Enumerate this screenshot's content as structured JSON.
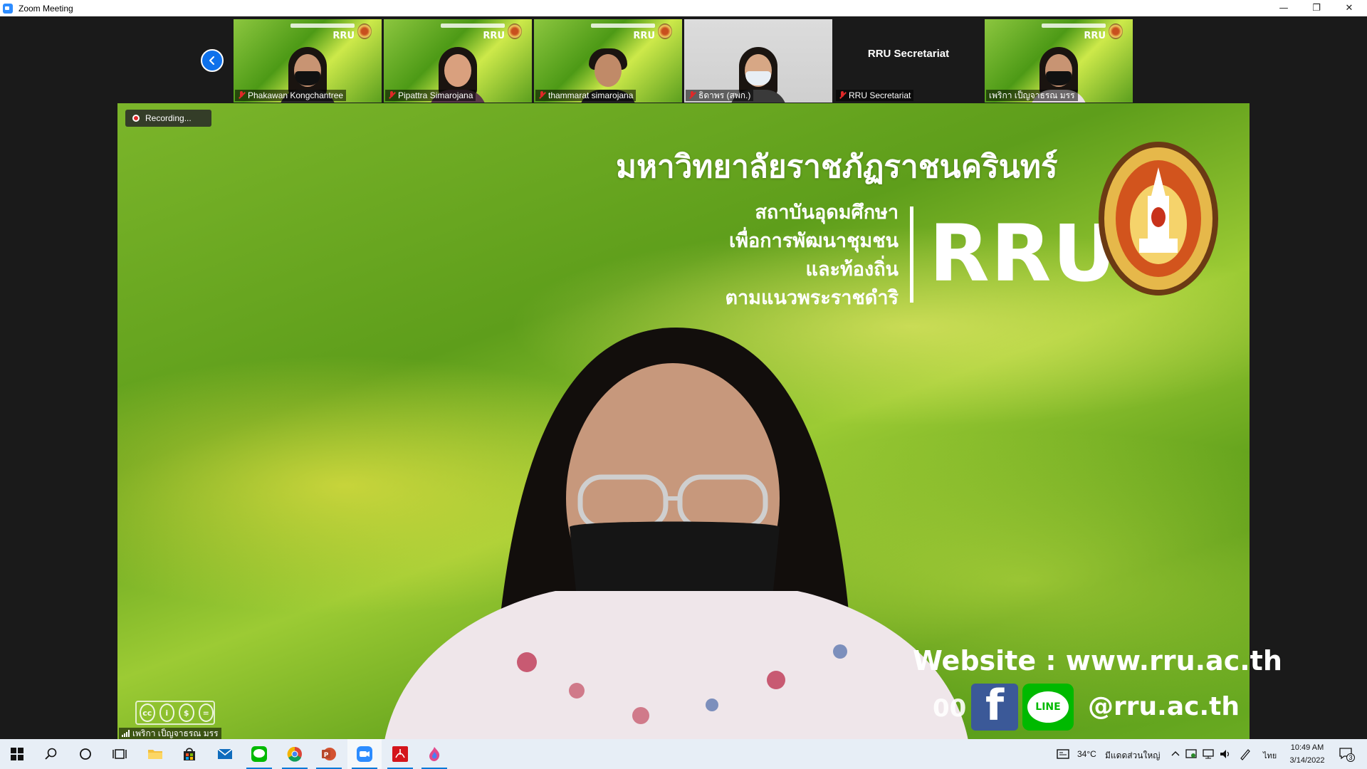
{
  "window": {
    "title": "Zoom Meeting",
    "minimize": "—",
    "maximize": "❐",
    "close": "✕"
  },
  "thumbnails": [
    {
      "name": "Phakawan Kongchantree",
      "muted": true,
      "bg": "green"
    },
    {
      "name": "Pipattra Simarojana",
      "muted": true,
      "bg": "green"
    },
    {
      "name": "thammarat simarojana",
      "muted": true,
      "bg": "green"
    },
    {
      "name": "ธิดาพร (สพก.)",
      "muted": true,
      "bg": "gray"
    },
    {
      "name": "RRU Secretariat",
      "center_label": "RRU Secretariat",
      "muted": true,
      "bg": "none"
    },
    {
      "name": "เพริกา เป็ญจาธรณ มรร",
      "muted": false,
      "bg": "green"
    }
  ],
  "recording": {
    "label": "Recording..."
  },
  "background_slide": {
    "university_name": "มหาวิทยาลัยราชภัฏราชนครินทร์",
    "sub_lines": [
      "สถาบันอุดมศึกษา",
      "เพื่อการพัฒนาชุมชน",
      "และท้องถิ่น",
      "ตามแนวพระราชดำริ"
    ],
    "acronym": "RRU",
    "website": "Website : www.rru.ac.th",
    "partial_text": "00",
    "line_label": "LINE",
    "social_handle": "@rru.ac.th",
    "facebook_letter": "f"
  },
  "cc_badge": [
    "cc",
    "i",
    "$",
    "="
  ],
  "main_speaker": {
    "name": "เพริกา เป็ญจาธรณ มรร"
  },
  "taskbar": {
    "temperature": "34°C",
    "weather": "มีแดดส่วนใหญ่",
    "language": "ไทย",
    "time": "10:49 AM",
    "date": "3/14/2022",
    "notification_count": "3"
  },
  "colors": {
    "zoom_blue": "#2d8cff",
    "brand_green": "#8cc63f",
    "muted_red": "#e02828",
    "taskbar_bg": "#e7eef6"
  }
}
